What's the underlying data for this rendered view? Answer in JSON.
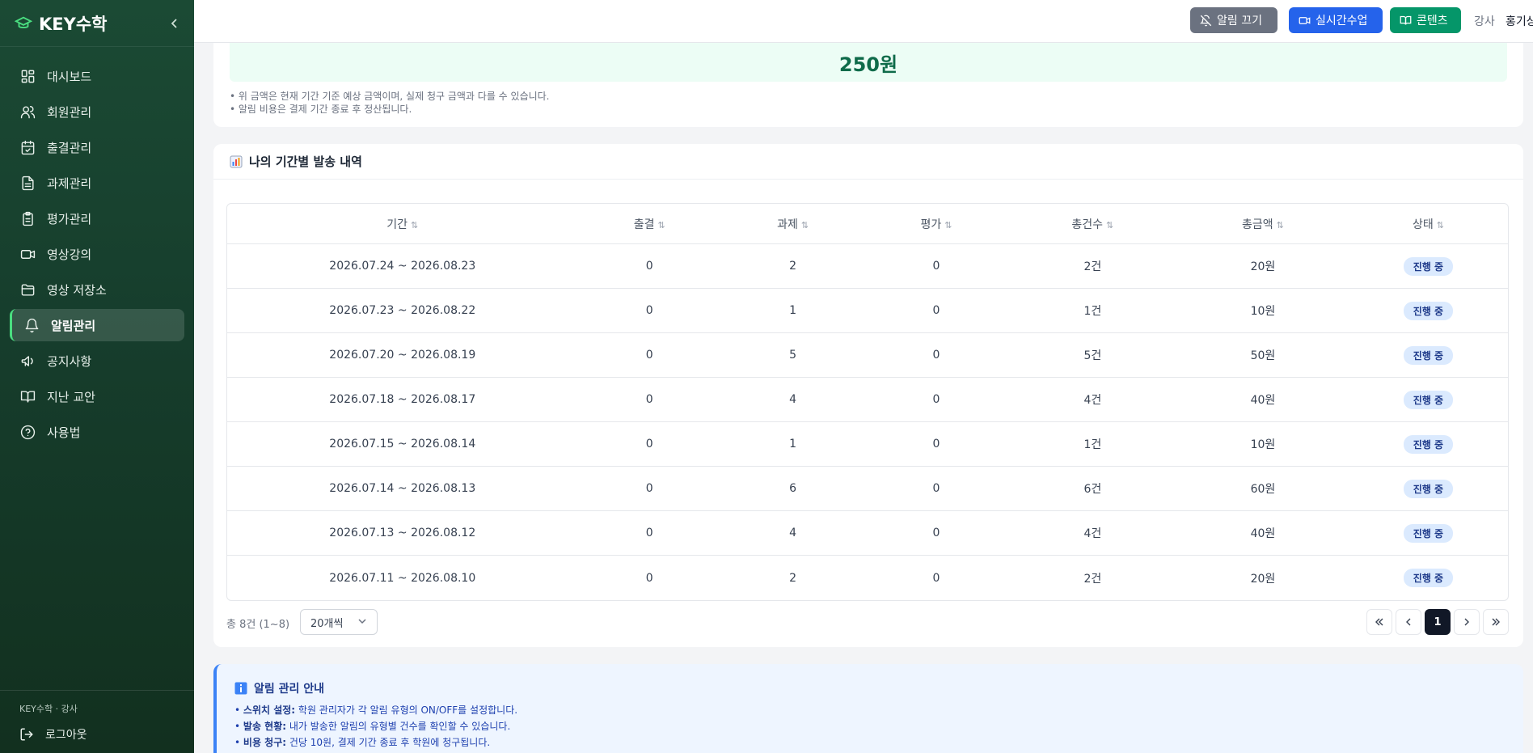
{
  "sidebar": {
    "brand": "KEY수학",
    "items": [
      {
        "label": "대시보드",
        "name": "sidebar-item-dashboard",
        "icon": "grid-icon"
      },
      {
        "label": "회원관리",
        "name": "sidebar-item-members",
        "icon": "users-icon"
      },
      {
        "label": "출결관리",
        "name": "sidebar-item-attendance",
        "icon": "calendar-check-icon"
      },
      {
        "label": "과제관리",
        "name": "sidebar-item-assignments",
        "icon": "document-icon"
      },
      {
        "label": "평가관리",
        "name": "sidebar-item-evaluation",
        "icon": "clipboard-icon"
      },
      {
        "label": "영상강의",
        "name": "sidebar-item-video-lectures",
        "icon": "video-icon"
      },
      {
        "label": "영상 저장소",
        "name": "sidebar-item-video-storage",
        "icon": "folder-icon"
      },
      {
        "label": "알림관리",
        "name": "sidebar-item-notifications",
        "icon": "bell-icon",
        "active": true
      },
      {
        "label": "공지사항",
        "name": "sidebar-item-notices",
        "icon": "megaphone-icon"
      },
      {
        "label": "지난 교안",
        "name": "sidebar-item-past-materials",
        "icon": "book-icon"
      },
      {
        "label": "사용법",
        "name": "sidebar-item-help",
        "icon": "help-icon"
      }
    ],
    "footer_role": "KEY수학 · 강사",
    "logout_label": "로그아웃"
  },
  "topbar": {
    "notify_off_label": "알림 끄기",
    "live_class_label": "실시간수업",
    "contents_label": "콘텐츠",
    "role_label": "강사",
    "user_name": "홍기상"
  },
  "summary": {
    "amount": "250원",
    "notes": [
      "• 위 금액은 현재 기간 기준 예상 금액이며, 실제 청구 금액과 다를 수 있습니다.",
      "• 알림 비용은 결제 기간 종료 후 정산됩니다."
    ]
  },
  "history": {
    "title": "나의 기간별 발송 내역",
    "columns": [
      "기간",
      "출결",
      "과제",
      "평가",
      "총건수",
      "총금액",
      "상태"
    ],
    "rows": [
      {
        "period": "2026.07.24 ~ 2026.08.23",
        "attendance": "0",
        "assignment": "2",
        "evaluation": "0",
        "count": "2건",
        "amount": "20원",
        "status": "진행 중"
      },
      {
        "period": "2026.07.23 ~ 2026.08.22",
        "attendance": "0",
        "assignment": "1",
        "evaluation": "0",
        "count": "1건",
        "amount": "10원",
        "status": "진행 중"
      },
      {
        "period": "2026.07.20 ~ 2026.08.19",
        "attendance": "0",
        "assignment": "5",
        "evaluation": "0",
        "count": "5건",
        "amount": "50원",
        "status": "진행 중"
      },
      {
        "period": "2026.07.18 ~ 2026.08.17",
        "attendance": "0",
        "assignment": "4",
        "evaluation": "0",
        "count": "4건",
        "amount": "40원",
        "status": "진행 중"
      },
      {
        "period": "2026.07.15 ~ 2026.08.14",
        "attendance": "0",
        "assignment": "1",
        "evaluation": "0",
        "count": "1건",
        "amount": "10원",
        "status": "진행 중"
      },
      {
        "period": "2026.07.14 ~ 2026.08.13",
        "attendance": "0",
        "assignment": "6",
        "evaluation": "0",
        "count": "6건",
        "amount": "60원",
        "status": "진행 중"
      },
      {
        "period": "2026.07.13 ~ 2026.08.12",
        "attendance": "0",
        "assignment": "4",
        "evaluation": "0",
        "count": "4건",
        "amount": "40원",
        "status": "진행 중"
      },
      {
        "period": "2026.07.11 ~ 2026.08.10",
        "attendance": "0",
        "assignment": "2",
        "evaluation": "0",
        "count": "2건",
        "amount": "20원",
        "status": "진행 중"
      }
    ],
    "total_text": "총 8건 (1~8)",
    "per_page": "20개씩",
    "current_page": "1"
  },
  "guide": {
    "title": "알림 관리 안내",
    "items": [
      {
        "key": "스위치 설정:",
        "text": " 학원 관리자가 각 알림 유형의 ON/OFF를 설정합니다."
      },
      {
        "key": "발송 현황:",
        "text": " 내가 발송한 알림의 유형별 건수를 확인할 수 있습니다."
      },
      {
        "key": "비용 청구:",
        "text": " 건당 10원, 결제 기간 종료 후 학원에 청구됩니다."
      }
    ]
  },
  "colors": {
    "sidebar_bg": "#1b4a34",
    "accent_green": "#059669",
    "accent_blue": "#2563eb",
    "badge_bg": "#dbeafe"
  }
}
